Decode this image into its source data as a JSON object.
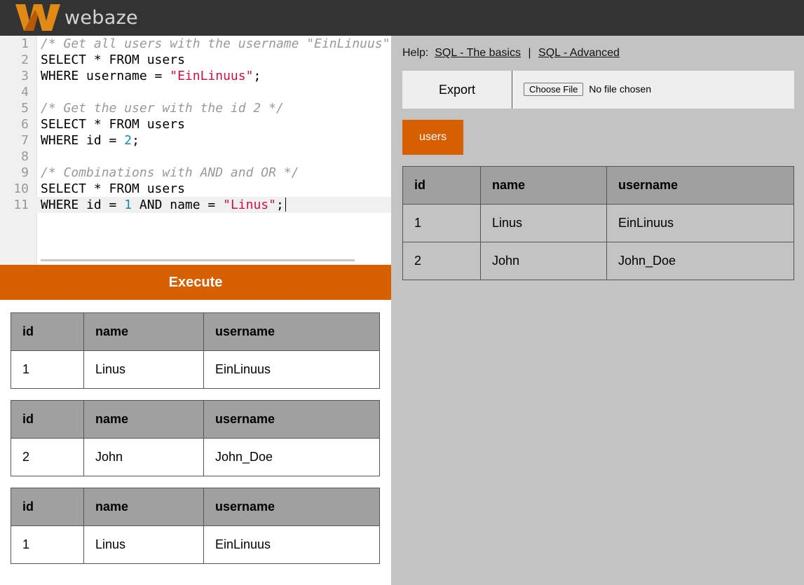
{
  "header": {
    "brand": "webaze"
  },
  "editor": {
    "lines": [
      {
        "n": "1",
        "parts": [
          {
            "t": "cm",
            "v": "/* Get all users with the username \"EinLinuus\" */"
          }
        ]
      },
      {
        "n": "2",
        "parts": [
          {
            "t": "kw",
            "v": "SELECT * FROM users"
          }
        ]
      },
      {
        "n": "3",
        "parts": [
          {
            "t": "kw",
            "v": "WHERE username = "
          },
          {
            "t": "str",
            "v": "\"EinLinuus\""
          },
          {
            "t": "kw",
            "v": ";"
          }
        ]
      },
      {
        "n": "4",
        "parts": []
      },
      {
        "n": "5",
        "parts": [
          {
            "t": "cm",
            "v": "/* Get the user with the id 2 */"
          }
        ]
      },
      {
        "n": "6",
        "parts": [
          {
            "t": "kw",
            "v": "SELECT * FROM users"
          }
        ]
      },
      {
        "n": "7",
        "parts": [
          {
            "t": "kw",
            "v": "WHERE id = "
          },
          {
            "t": "num",
            "v": "2"
          },
          {
            "t": "kw",
            "v": ";"
          }
        ]
      },
      {
        "n": "8",
        "parts": []
      },
      {
        "n": "9",
        "parts": [
          {
            "t": "cm",
            "v": "/* Combinations with AND and OR */"
          }
        ]
      },
      {
        "n": "10",
        "parts": [
          {
            "t": "kw",
            "v": "SELECT * FROM users"
          }
        ]
      },
      {
        "n": "11",
        "parts": [
          {
            "t": "kw",
            "v": "WHERE id = "
          },
          {
            "t": "num",
            "v": "1"
          },
          {
            "t": "kw",
            "v": " AND name = "
          },
          {
            "t": "str",
            "v": "\"Linus\""
          },
          {
            "t": "kw",
            "v": ";"
          }
        ],
        "active": true
      }
    ]
  },
  "execute_label": "Execute",
  "results": [
    {
      "headers": [
        "id",
        "name",
        "username"
      ],
      "rows": [
        [
          "1",
          "Linus",
          "EinLinuus"
        ]
      ]
    },
    {
      "headers": [
        "id",
        "name",
        "username"
      ],
      "rows": [
        [
          "2",
          "John",
          "John_Doe"
        ]
      ]
    },
    {
      "headers": [
        "id",
        "name",
        "username"
      ],
      "rows": [
        [
          "1",
          "Linus",
          "EinLinuus"
        ]
      ]
    }
  ],
  "help": {
    "label": "Help:",
    "link1": "SQL - The basics",
    "separator": "|",
    "link2": "SQL - Advanced"
  },
  "export_label": "Export",
  "file_input": {
    "button": "Choose File",
    "status": "No file chosen"
  },
  "tables_tab": "users",
  "users_table": {
    "headers": [
      "id",
      "name",
      "username"
    ],
    "rows": [
      [
        "1",
        "Linus",
        "EinLinuus"
      ],
      [
        "2",
        "John",
        "John_Doe"
      ]
    ]
  },
  "colors": {
    "accent": "#d65f00",
    "header_bg": "#333333",
    "panel_bg": "#c3c3c3",
    "table_header": "#a0a0a0",
    "string": "#cc1144",
    "number": "#168c9c",
    "comment": "#999999"
  }
}
